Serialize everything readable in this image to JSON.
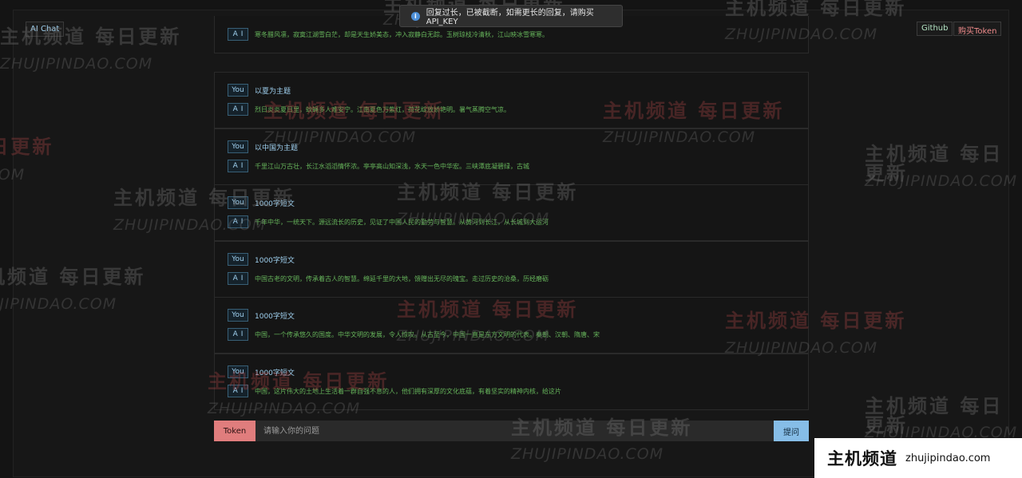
{
  "header": {
    "brand": "AI Chat",
    "github": "Github",
    "buy_token": "购买Token"
  },
  "toast": {
    "icon": "info-icon",
    "text": "回复过长，已被截断，如需更长的回复，请购买API_KEY"
  },
  "user_tag": "You",
  "ai_tag": "AI",
  "messages": [
    {
      "question": "",
      "answer": "寒冬腊风凛，寂寞江湖雪白茫，却是天生娇美态，冲入寂静白无踪。玉树琼枝冷清秋，江山映冰雪寒寒。"
    },
    {
      "question": "以夏为主题",
      "answer": "烈日炎炎夏日里，蚊蝇多人难安宁。江南夏色万紫红，荷花绽放娇艳明。暑气蒸腾空气凉。"
    },
    {
      "question": "以中国为主题",
      "answer": "千里江山万古壮，长江水滔滔情怀浓。亭亭高山知深浅，水天一色中华宏。三峡潭底凝碧绿，古城"
    },
    {
      "question": "1000字短文",
      "answer": "千年中华，一统天下。源远流长的历史，见证了中国人民的勤劳与智慧。从黄河到长江，从长城到大运河"
    },
    {
      "question": "1000字短文",
      "answer": "中国古老的文明，传承着古人的智慧。绵延千里的大地，馈赠出无尽的瑰宝。走过历史的沧桑，历经磨砺"
    },
    {
      "question": "1000字短文",
      "answer": "中国，一个传承悠久的国度。中华文明的发展，令人惊叹。从古至今，中国一直是东方文明的代表。秦朝、汉朝、隋唐、宋"
    },
    {
      "question": "1000字短文",
      "answer": "中国，这片伟大的土地上生活着一群自强不息的人，他们拥有深厚的文化底蕴，有着坚实的精神内核，给这片"
    }
  ],
  "input": {
    "token_label": "Token",
    "placeholder": "请输入你的问题",
    "ask_label": "提问"
  },
  "watermark": {
    "cn": "主机频道 每日更新",
    "en": "ZHUJIPINDAO.COM"
  },
  "corner_logo": {
    "cn": "主机频道",
    "en": "zhujipindao.com"
  }
}
